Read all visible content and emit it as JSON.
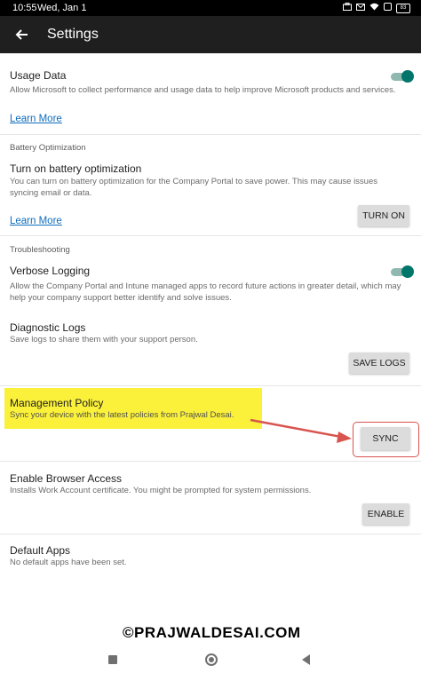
{
  "status_bar": {
    "time": "10:55",
    "date": "Wed, Jan 1",
    "battery": "83"
  },
  "app_bar": {
    "title": "Settings"
  },
  "usage_data": {
    "title": "Usage Data",
    "description": "Allow Microsoft to collect performance and usage data to help improve Microsoft products and services.",
    "toggle_on": true,
    "link": "Learn More"
  },
  "battery_optimization": {
    "header": "Battery Optimization",
    "title": "Turn on battery optimization",
    "description": "You can turn on battery optimization for the Company Portal to save power. This may cause issues syncing email or data.",
    "link": "Learn More",
    "button": "TURN ON"
  },
  "troubleshooting": {
    "header": "Troubleshooting",
    "verbose_title": "Verbose Logging",
    "verbose_description": "Allow the Company Portal and Intune managed apps to record future actions in greater detail, which may help your company support better identify and solve issues.",
    "verbose_toggle_on": true,
    "diag_title": "Diagnostic Logs",
    "diag_description": "Save logs to share them with your support person.",
    "diag_button": "SAVE LOGS"
  },
  "management_policy": {
    "title": "Management Policy",
    "description": "Sync your device with the latest policies from Prajwal Desai.",
    "button": "SYNC"
  },
  "browser_access": {
    "title": "Enable Browser Access",
    "description": "Installs Work Account certificate. You might be prompted for system permissions.",
    "button": "ENABLE"
  },
  "default_apps": {
    "title": "Default Apps",
    "description": "No default apps have been set."
  },
  "watermark": "©PRAJWALDESAI.COM",
  "colors": {
    "accent_toggle": "#00756a",
    "link": "#0f6cbd",
    "highlight": "#fbf13a",
    "annotation": "#d9534f"
  }
}
